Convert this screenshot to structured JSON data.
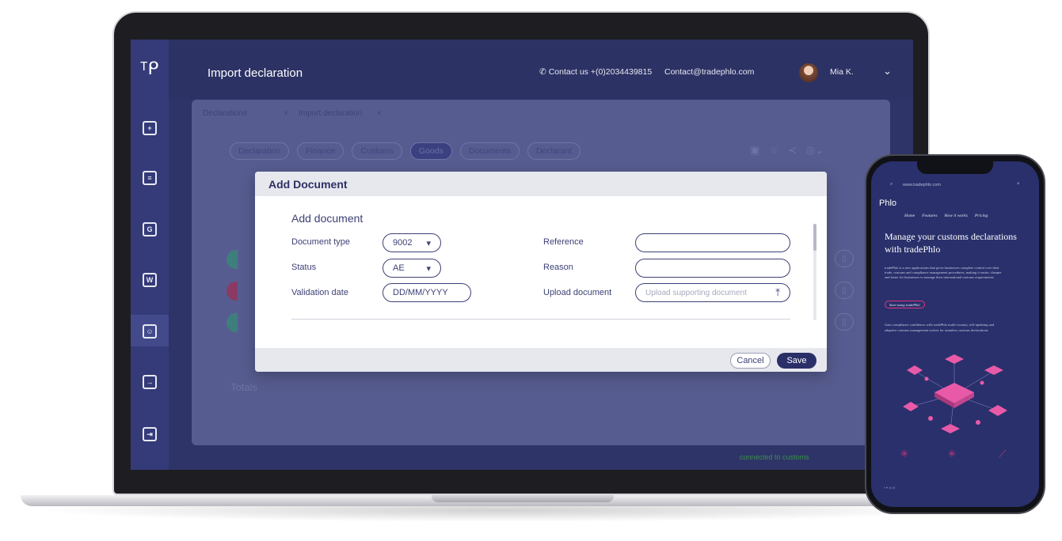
{
  "laptop": {
    "header": {
      "title": "Import declaration",
      "contact_phone": "Contact us +(0)2034439815",
      "contact_email": "Contact@tradephlo.com",
      "user_name": "Mia K."
    },
    "breadcrumbs": [
      "Declarations",
      "×",
      "Import declaration",
      "×"
    ],
    "tabs": [
      {
        "label": "Declaration"
      },
      {
        "label": "Finance"
      },
      {
        "label": "Customs"
      },
      {
        "label": "Goods"
      },
      {
        "label": "Documents"
      },
      {
        "label": "Declarant"
      }
    ],
    "totals_label": "Totals",
    "status_text": "connected to customs",
    "modal": {
      "title": "Add Document",
      "subtitle": "Add document",
      "fields": {
        "document_type_label": "Document type",
        "document_type_value": "9002",
        "status_label": "Status",
        "status_value": "AE",
        "validation_date_label": "Validation date",
        "validation_date_placeholder": "DD/MM/YYYY",
        "reference_label": "Reference",
        "reason_label": "Reason",
        "upload_label": "Upload document",
        "upload_placeholder": "Upload supporting document"
      },
      "cancel_label": "Cancel",
      "save_label": "Save"
    }
  },
  "phone": {
    "url": "www.tradephlo.com",
    "logo": "Phlo",
    "nav": [
      "Home",
      "Features",
      "How it works",
      "Pricing"
    ],
    "hero_title": "Manage your customs declarations with tradePhlo",
    "hero_text": "tradePhlo is a new applications that gives businesses complete control over their trade, customs and compliance management procedures, making it easier, cheaper and faster for businesses to manage their international customs requirements.",
    "cta_label": "Start using tradePhlo",
    "sub_text": "Gain compliance confidence with tradePhlo multi-country, self-updating and adaptive customs management toolset for seamless customs declarations"
  },
  "colors": {
    "brand_navy": "#2c3264",
    "accent_pink": "#e0337e",
    "save_button": "#2b2f68"
  }
}
